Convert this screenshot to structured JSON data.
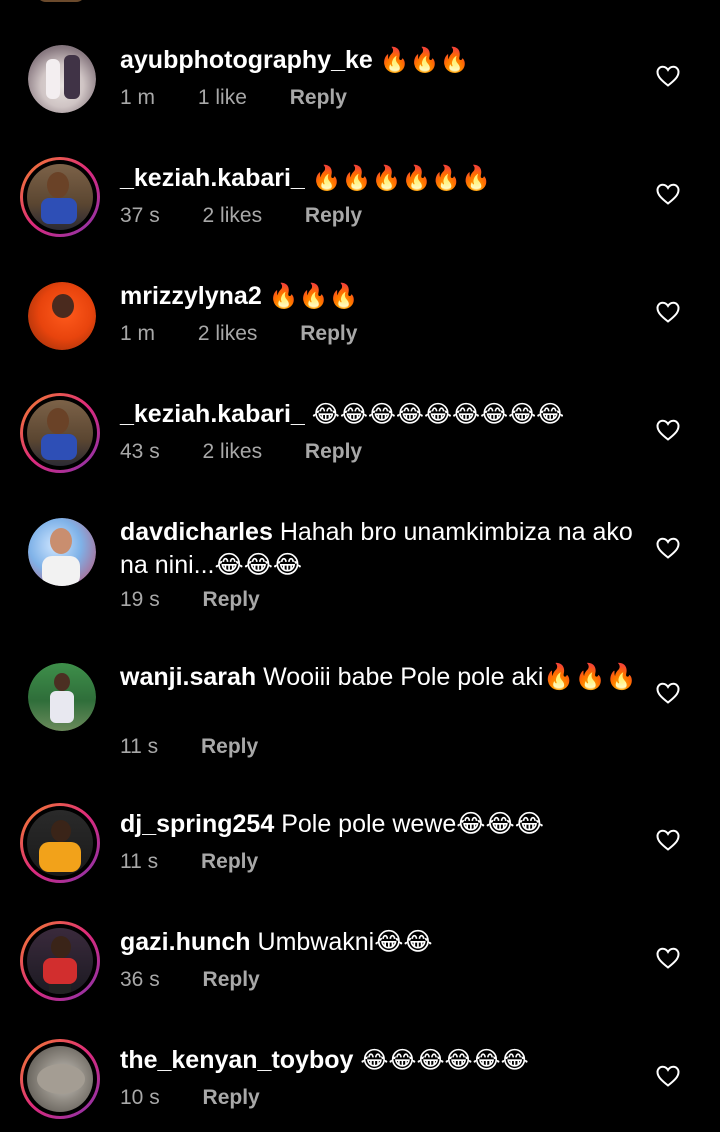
{
  "comments": [
    {
      "username": "ayubphotography_ke",
      "text": "🔥🔥🔥",
      "time": "1 m",
      "likes": "1 like",
      "reply": "Reply"
    },
    {
      "username": "_keziah.kabari_",
      "text": "🔥🔥🔥🔥🔥🔥",
      "time": "37 s",
      "likes": "2 likes",
      "reply": "Reply"
    },
    {
      "username": "mrizzylyna2",
      "text": "🔥🔥🔥",
      "time": "1 m",
      "likes": "2 likes",
      "reply": "Reply"
    },
    {
      "username": "_keziah.kabari_",
      "text": "😂😂😂😂😂😂😂😂😂",
      "time": "43 s",
      "likes": "2 likes",
      "reply": "Reply"
    },
    {
      "username": "davdicharles",
      "text": "Hahah bro unamkimbiza na ako na nini...😂😂😂",
      "time": "19 s",
      "likes": "",
      "reply": "Reply"
    },
    {
      "username": "wanji.sarah",
      "text": "Wooiii babe Pole pole aki🔥🔥🔥",
      "time": "11 s",
      "likes": "",
      "reply": "Reply"
    },
    {
      "username": "dj_spring254",
      "text": "Pole pole wewe😂😂😂",
      "time": "11 s",
      "likes": "",
      "reply": "Reply"
    },
    {
      "username": "gazi.hunch",
      "text": "Umbwakni😂😂",
      "time": "36 s",
      "likes": "",
      "reply": "Reply"
    },
    {
      "username": "the_kenyan_toyboy",
      "text": "😂😂😂😂😂😂",
      "time": "10 s",
      "likes": "",
      "reply": "Reply"
    }
  ],
  "icons": {
    "like": "heart-outline-icon"
  },
  "colors": {
    "background": "#000000",
    "meta": "#a8a8a8",
    "story_ring": "#dd2a7b"
  }
}
